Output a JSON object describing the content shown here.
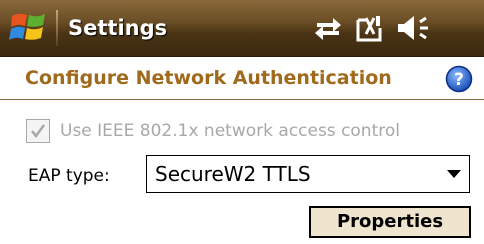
{
  "window": {
    "title": "Settings"
  },
  "colors": {
    "titlebar": "#5a4020",
    "header_text": "#a06a1c",
    "disabled_text": "#a8a8a8",
    "button_face": "#efe4ce",
    "help_blue": "#2060c8"
  },
  "status_icons": [
    "connectivity-icon",
    "no-phone-signal-icon",
    "volume-icon"
  ],
  "page": {
    "title": "Configure Network Authentication",
    "help_icon": "help-icon"
  },
  "ieee_checkbox": {
    "label": "Use IEEE 802.1x network access control",
    "checked": true,
    "enabled": false
  },
  "eap": {
    "label": "EAP type:",
    "selected": "SecureW2 TTLS"
  },
  "actions": {
    "properties_label": "Properties"
  }
}
